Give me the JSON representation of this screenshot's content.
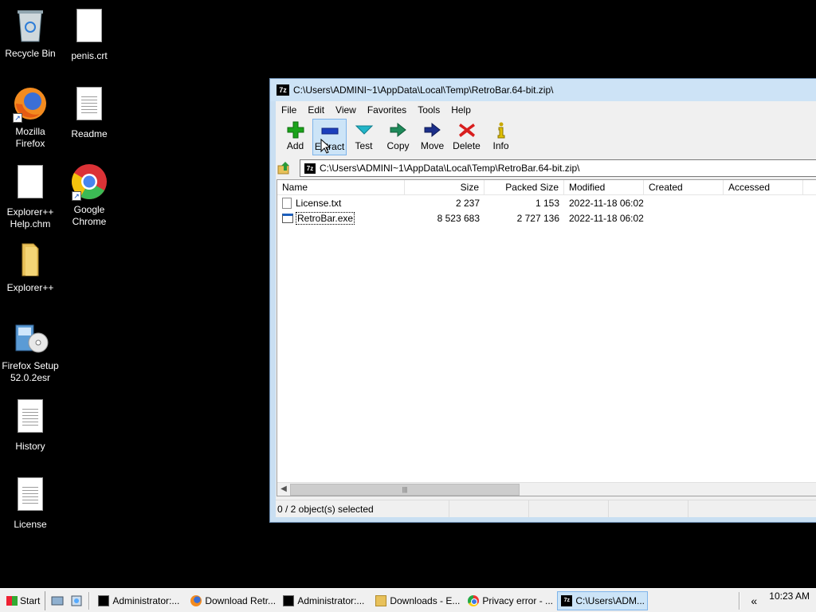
{
  "desktop": {
    "icons": [
      {
        "label": "Recycle Bin"
      },
      {
        "label": "penis.crt"
      },
      {
        "label": "Mozilla Firefox"
      },
      {
        "label": "Readme"
      },
      {
        "label": "Explorer++ Help.chm"
      },
      {
        "label": "Google Chrome"
      },
      {
        "label": "Explorer++"
      },
      {
        "label": "Firefox Setup 52.0.2esr"
      },
      {
        "label": "History"
      },
      {
        "label": "License"
      }
    ]
  },
  "window": {
    "title": "C:\\Users\\ADMINI~1\\AppData\\Local\\Temp\\RetroBar.64-bit.zip\\",
    "app_icon": "7z",
    "menu": [
      "File",
      "Edit",
      "View",
      "Favorites",
      "Tools",
      "Help"
    ],
    "toolbar": [
      {
        "label": "Add",
        "icon": "plus-icon",
        "color": "#1aa31a"
      },
      {
        "label": "Extract",
        "icon": "minus-icon",
        "color": "#1c3fbd"
      },
      {
        "label": "Test",
        "icon": "check-icon",
        "color": "#22b5c8"
      },
      {
        "label": "Copy",
        "icon": "copy-arrow-icon",
        "color": "#1f8a5a"
      },
      {
        "label": "Move",
        "icon": "move-arrow-icon",
        "color": "#1c2f8a"
      },
      {
        "label": "Delete",
        "icon": "x-icon",
        "color": "#d81e1e"
      },
      {
        "label": "Info",
        "icon": "info-icon",
        "color": "#c8a800"
      }
    ],
    "address": "C:\\Users\\ADMINI~1\\AppData\\Local\\Temp\\RetroBar.64-bit.zip\\",
    "columns": [
      "Name",
      "Size",
      "Packed Size",
      "Modified",
      "Created",
      "Accessed"
    ],
    "rows": [
      {
        "name": "License.txt",
        "size": "2 237",
        "packed": "1 153",
        "modified": "2022-11-18 06:02",
        "created": "",
        "accessed": ""
      },
      {
        "name": "RetroBar.exe",
        "size": "8 523 683",
        "packed": "2 727 136",
        "modified": "2022-11-18 06:02",
        "created": "",
        "accessed": ""
      }
    ],
    "status": "0 / 2 object(s) selected"
  },
  "taskbar": {
    "start": "Start",
    "items": [
      {
        "label": "Administrator:...",
        "icon": "cmd-icon"
      },
      {
        "label": "Download Retr...",
        "icon": "firefox-icon"
      },
      {
        "label": "Administrator:...",
        "icon": "cmd-icon"
      },
      {
        "label": "Downloads - E...",
        "icon": "folder-icon"
      },
      {
        "label": "Privacy error - ...",
        "icon": "chrome-icon"
      },
      {
        "label": "C:\\Users\\ADM...",
        "icon": "7zip-icon"
      }
    ],
    "tray_chevron": "«",
    "clock": "10:23 AM"
  }
}
